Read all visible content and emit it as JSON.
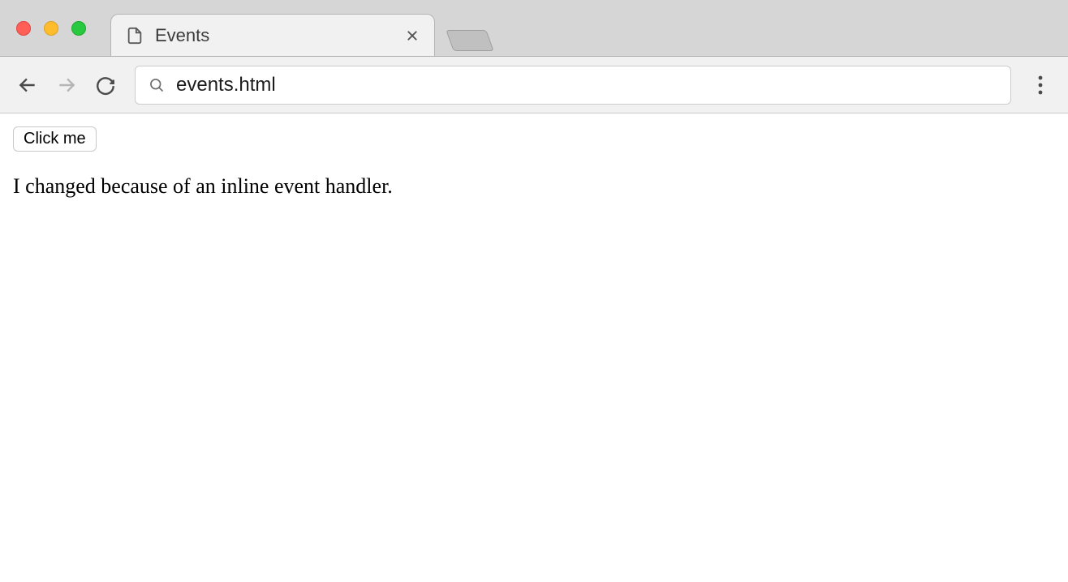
{
  "window": {
    "tab": {
      "title": "Events"
    }
  },
  "toolbar": {
    "url": "events.html"
  },
  "page": {
    "button_label": "Click me",
    "paragraph_text": "I changed because of an inline event handler."
  }
}
